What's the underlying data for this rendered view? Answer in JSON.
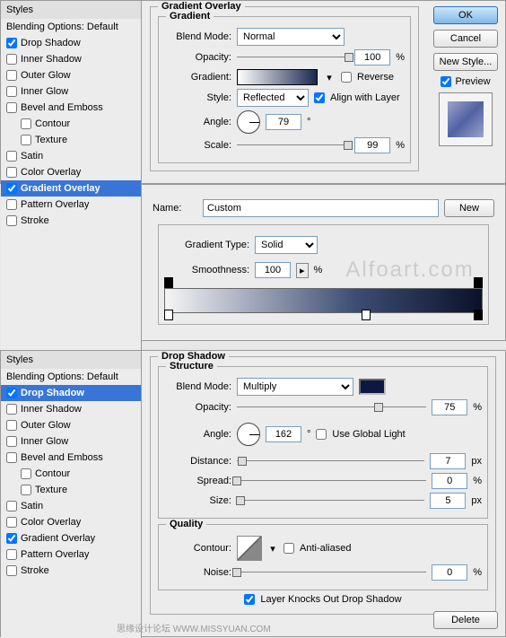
{
  "top": {
    "styles_hdr": "Styles",
    "blending": "Blending Options: Default",
    "items": [
      {
        "label": "Drop Shadow",
        "c": true
      },
      {
        "label": "Inner Shadow",
        "c": false
      },
      {
        "label": "Outer Glow",
        "c": false
      },
      {
        "label": "Inner Glow",
        "c": false
      },
      {
        "label": "Bevel and Emboss",
        "c": false
      },
      {
        "label": "Contour",
        "c": false,
        "i": true
      },
      {
        "label": "Texture",
        "c": false,
        "i": true
      },
      {
        "label": "Satin",
        "c": false
      },
      {
        "label": "Color Overlay",
        "c": false
      },
      {
        "label": "Gradient Overlay",
        "c": true,
        "sel": true
      },
      {
        "label": "Pattern Overlay",
        "c": false
      },
      {
        "label": "Stroke",
        "c": false
      }
    ],
    "go": {
      "title": "Gradient Overlay",
      "leg": "Gradient",
      "blend": "Blend Mode:",
      "blend_v": "Normal",
      "opacity": "Opacity:",
      "opacity_v": "100",
      "pct": "%",
      "gradient": "Gradient:",
      "reverse": "Reverse",
      "style": "Style:",
      "style_v": "Reflected",
      "align": "Align with Layer",
      "angle": "Angle:",
      "angle_v": "79",
      "deg": "°",
      "scale": "Scale:",
      "scale_v": "99"
    },
    "btn_ok": "OK",
    "btn_cancel": "Cancel",
    "btn_new": "New Style...",
    "preview": "Preview"
  },
  "ged": {
    "name": "Name:",
    "name_v": "Custom",
    "new": "New",
    "type": "Gradient Type:",
    "type_v": "Solid",
    "smooth": "Smoothness:",
    "smooth_v": "100",
    "pct": "%",
    "wm": "Alfoart.com"
  },
  "bot": {
    "styles_hdr": "Styles",
    "blending": "Blending Options: Default",
    "items": [
      {
        "label": "Drop Shadow",
        "c": true,
        "sel": true
      },
      {
        "label": "Inner Shadow",
        "c": false
      },
      {
        "label": "Outer Glow",
        "c": false
      },
      {
        "label": "Inner Glow",
        "c": false
      },
      {
        "label": "Bevel and Emboss",
        "c": false
      },
      {
        "label": "Contour",
        "c": false,
        "i": true
      },
      {
        "label": "Texture",
        "c": false,
        "i": true
      },
      {
        "label": "Satin",
        "c": false
      },
      {
        "label": "Color Overlay",
        "c": false
      },
      {
        "label": "Gradient Overlay",
        "c": true
      },
      {
        "label": "Pattern Overlay",
        "c": false
      },
      {
        "label": "Stroke",
        "c": false
      }
    ],
    "ds": {
      "title": "Drop Shadow",
      "struct": "Structure",
      "blend": "Blend Mode:",
      "blend_v": "Multiply",
      "opacity": "Opacity:",
      "opacity_v": "75",
      "pct": "%",
      "angle": "Angle:",
      "angle_v": "162",
      "deg": "°",
      "ugl": "Use Global Light",
      "dist": "Distance:",
      "dist_v": "7",
      "px": "px",
      "spread": "Spread:",
      "spread_v": "0",
      "size": "Size:",
      "size_v": "5",
      "quality": "Quality",
      "contour": "Contour:",
      "aa": "Anti-aliased",
      "noise": "Noise:",
      "noise_v": "0",
      "knock": "Layer Knocks Out Drop Shadow"
    },
    "delete": "Delete"
  },
  "footer": "思缘设计论坛  WWW.MISSYUAN.COM"
}
